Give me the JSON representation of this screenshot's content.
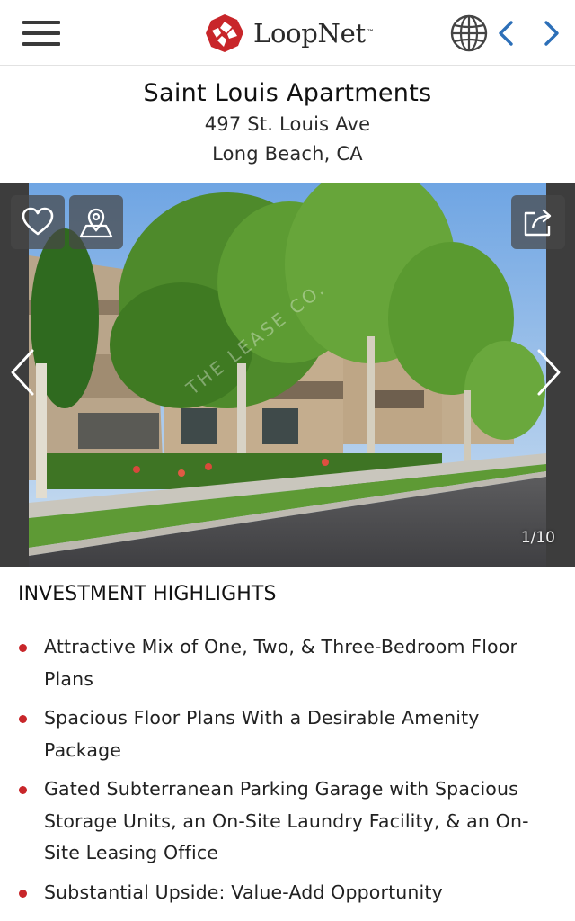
{
  "header": {
    "logo_text": "LoopNet",
    "logo_tm": "™",
    "brand_color": "#c8262a",
    "nav_color": "#2c6fb8",
    "icons": [
      "menu-icon",
      "globe-icon",
      "chevron-left-icon",
      "chevron-right-icon"
    ]
  },
  "listing": {
    "title": "Saint Louis Apartments",
    "address_line1": "497 St. Louis Ave",
    "address_line2": "Long Beach, CA"
  },
  "gallery": {
    "counter": "1/10",
    "current": 1,
    "total": 10,
    "icons": [
      "heart-icon",
      "map-pin-icon",
      "share-icon",
      "chevron-left-icon",
      "chevron-right-icon"
    ]
  },
  "highlights": {
    "heading": "INVESTMENT HIGHLIGHTS",
    "bullet_color": "#c8262a",
    "items": [
      "Attractive Mix of One, Two, & Three-Bedroom Floor Plans",
      "Spacious Floor Plans With a Desirable Amenity Package",
      "Gated Subterranean Parking Garage with Spacious Storage Units, an On-Site Laundry Facility, & an On-Site Leasing Office",
      "Substantial Upside: Value-Add Opportunity"
    ]
  }
}
